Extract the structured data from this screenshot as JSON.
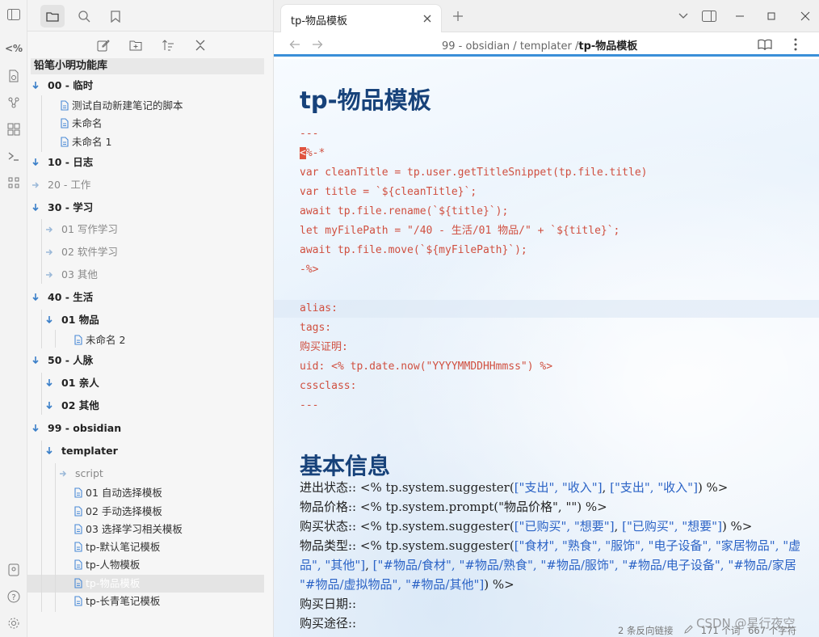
{
  "ribbon": {
    "items": [
      "sidebar-toggle",
      "templater-icon",
      "new-file-icon",
      "graph-icon",
      "canvas-icon",
      "terminal-icon",
      "plugin-icon",
      "vault-icon",
      "help-icon",
      "settings-icon"
    ],
    "templater_glyph": "<%"
  },
  "sidebar": {
    "vault_name": "铅笔小明功能库",
    "tree": [
      {
        "label": "00 - 临时",
        "type": "folder"
      },
      {
        "label": "测试自动新建笔记的脚本",
        "type": "file"
      },
      {
        "label": "未命名",
        "type": "file"
      },
      {
        "label": "未命名 1",
        "type": "file"
      },
      {
        "label": "10 - 日志",
        "type": "folder"
      },
      {
        "label": "20 - 工作",
        "type": "folder-collapsed"
      },
      {
        "label": "30 - 学习",
        "type": "folder"
      },
      {
        "label": "01 写作学习",
        "type": "folder-collapsed"
      },
      {
        "label": "02 软件学习",
        "type": "folder-collapsed"
      },
      {
        "label": "03 其他",
        "type": "folder-collapsed"
      },
      {
        "label": "40 - 生活",
        "type": "folder"
      },
      {
        "label": "01 物品",
        "type": "folder"
      },
      {
        "label": "未命名 2",
        "type": "file"
      },
      {
        "label": "50 - 人脉",
        "type": "folder"
      },
      {
        "label": "01 亲人",
        "type": "folder"
      },
      {
        "label": "02 其他",
        "type": "folder"
      },
      {
        "label": "99 - obsidian",
        "type": "folder"
      },
      {
        "label": "templater",
        "type": "folder"
      },
      {
        "label": "script",
        "type": "folder-collapsed"
      },
      {
        "label": "01 自动选择模板",
        "type": "file"
      },
      {
        "label": "02 手动选择模板",
        "type": "file"
      },
      {
        "label": "03 选择学习相关模板",
        "type": "file"
      },
      {
        "label": "tp-默认笔记模板",
        "type": "file"
      },
      {
        "label": "tp-人物模板",
        "type": "file"
      },
      {
        "label": "tp-物品模板",
        "type": "file",
        "selected": true
      },
      {
        "label": "tp-长青笔记模板",
        "type": "file"
      }
    ]
  },
  "tab": {
    "title": "tp-物品模板"
  },
  "breadcrumb": {
    "part1": "99 - obsidian",
    "sep1": " / ",
    "part2": "templater",
    "sep2": " /",
    "current": "tp-物品模板"
  },
  "document": {
    "title": "tp-物品模板",
    "code_lines": [
      "---",
      "<%-*",
      "var cleanTitle = tp.user.getTitleSnippet(tp.file.title)",
      "var title = `${cleanTitle}`;",
      "await tp.file.rename(`${title}`);",
      "let myFilePath = \"/40 - 生活/01 物品/\" + `${title}`;",
      "await tp.file.move(`${myFilePath}`);",
      "-%>",
      "",
      "alias:",
      "tags:",
      "购买证明:",
      "uid: <% tp.date.now(\"YYYYMMDDHHmmss\") %>",
      "cssclass:",
      "---"
    ],
    "heading2": "基本信息",
    "props": {
      "line1_a": "进出状态:: <% tp.system.suggester(",
      "line1_b": "[\"支出\", \"收入\"]",
      "line1_c": ", ",
      "line1_d": "[\"支出\", \"收入\"]",
      "line1_e": ") %>",
      "line2": "物品价格:: <% tp.system.prompt(\"物品价格\", \"\") %>",
      "line3_a": "购买状态:: <% tp.system.suggester(",
      "line3_b": "[\"已购买\", \"想要\"]",
      "line3_c": ", ",
      "line3_d": "[\"已购买\", \"想要\"]",
      "line3_e": ") %>",
      "line4_a": "物品类型:: <% tp.system.suggester(",
      "line4_b": "[\"食材\", \"熟食\", \"服饰\", \"电子设备\", \"家居物品\", \"虚",
      "line5_a": "品\", \"其他\"]",
      "line5_b": ", ",
      "line5_c": "[\"#物品/食材\", \"#物品/熟食\", \"#物品/服饰\", \"#物品/电子设备\", \"#物品/家居",
      "line6_a": "\"#物品/虚拟物品\", \"#物品/其他\"]",
      "line6_b": ") %>",
      "line7": "购买日期::",
      "line8": "购买途径::"
    }
  },
  "status_bar": {
    "backlinks": "2 条反向链接",
    "words": "171 个词",
    "chars": "667 个字符"
  },
  "watermark": "CSDN @星行夜空",
  "colors": {
    "accent": "#3a8fd8",
    "title": "#17427a",
    "code": "#d04f3f",
    "link": "#2b63c6"
  }
}
